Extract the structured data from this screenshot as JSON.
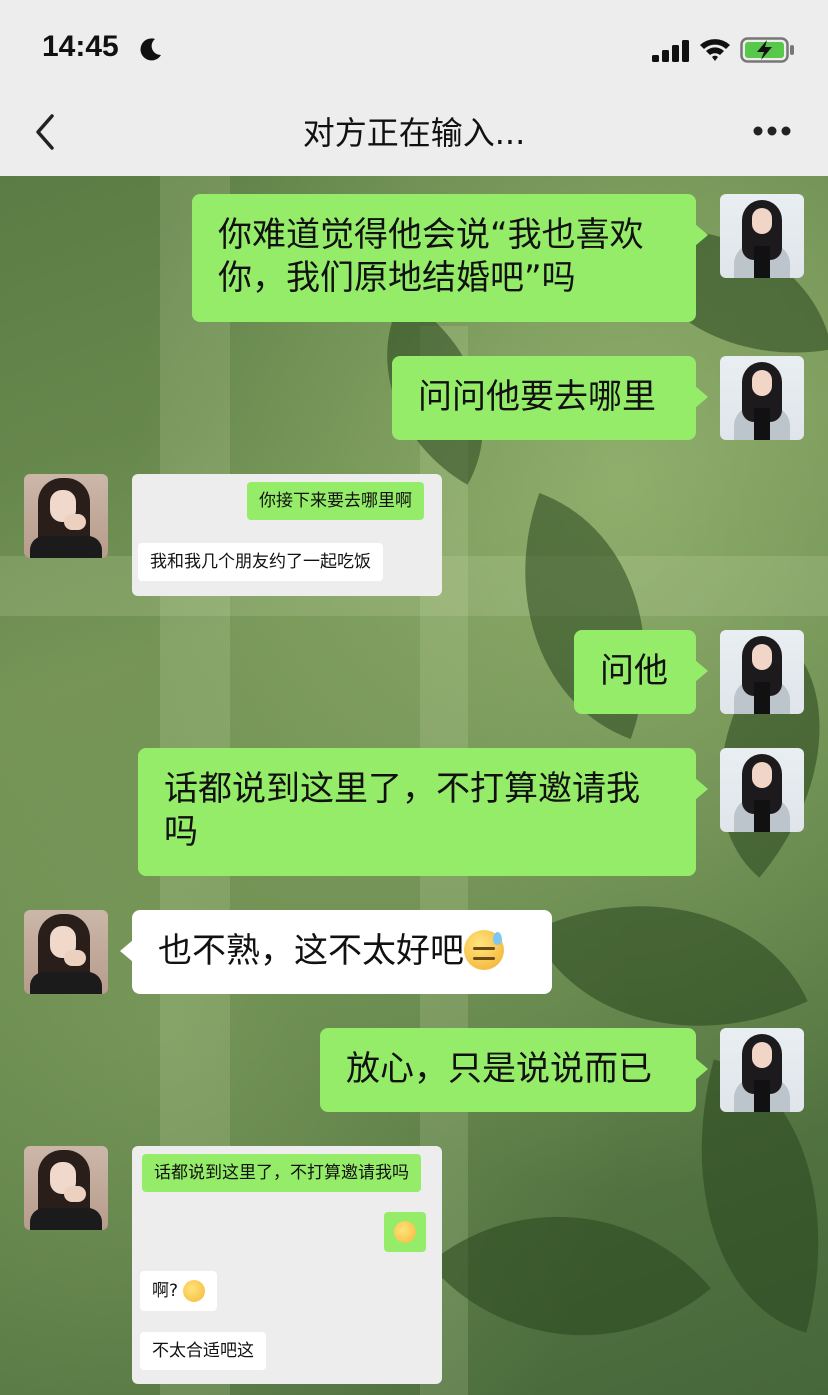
{
  "status_bar": {
    "time": "14:45",
    "icons": [
      "moon-icon",
      "signal-icon",
      "wifi-icon",
      "battery-charging-icon"
    ]
  },
  "nav": {
    "title": "对方正在输入...",
    "back_icon": "chevron-left-icon",
    "more_icon": "more-dots-icon"
  },
  "colors": {
    "sent_bubble": "#95ec69",
    "received_bubble": "#ffffff",
    "nav_bar": "#ededed"
  },
  "messages": [
    {
      "from": "me",
      "text": "你难道觉得他会说“我也喜欢你，我们原地结婚吧”吗"
    },
    {
      "from": "me",
      "text": "问问他要去哪里"
    },
    {
      "from": "her",
      "type": "screenshot",
      "items": [
        {
          "side": "right",
          "text": "你接下来要去哪里啊"
        },
        {
          "side": "left",
          "text": "我和我几个朋友约了一起吃饭"
        }
      ]
    },
    {
      "from": "me",
      "text": "问他"
    },
    {
      "from": "me",
      "text": "话都说到这里了，不打算邀请我吗"
    },
    {
      "from": "her",
      "text": "也不熟，这不太好吧",
      "emoji": "sweat-smile-emoji"
    },
    {
      "from": "me",
      "text": "放心，只是说说而已"
    },
    {
      "from": "her",
      "type": "screenshot",
      "items": [
        {
          "side": "right",
          "text": "话都说到这里了，不打算邀请我吗"
        },
        {
          "side": "right",
          "emoji": "grin-emoji"
        },
        {
          "side": "left",
          "text": "啊?",
          "emoji": "flushed-emoji"
        },
        {
          "side": "left",
          "text": "不太合适吧这"
        }
      ]
    }
  ]
}
